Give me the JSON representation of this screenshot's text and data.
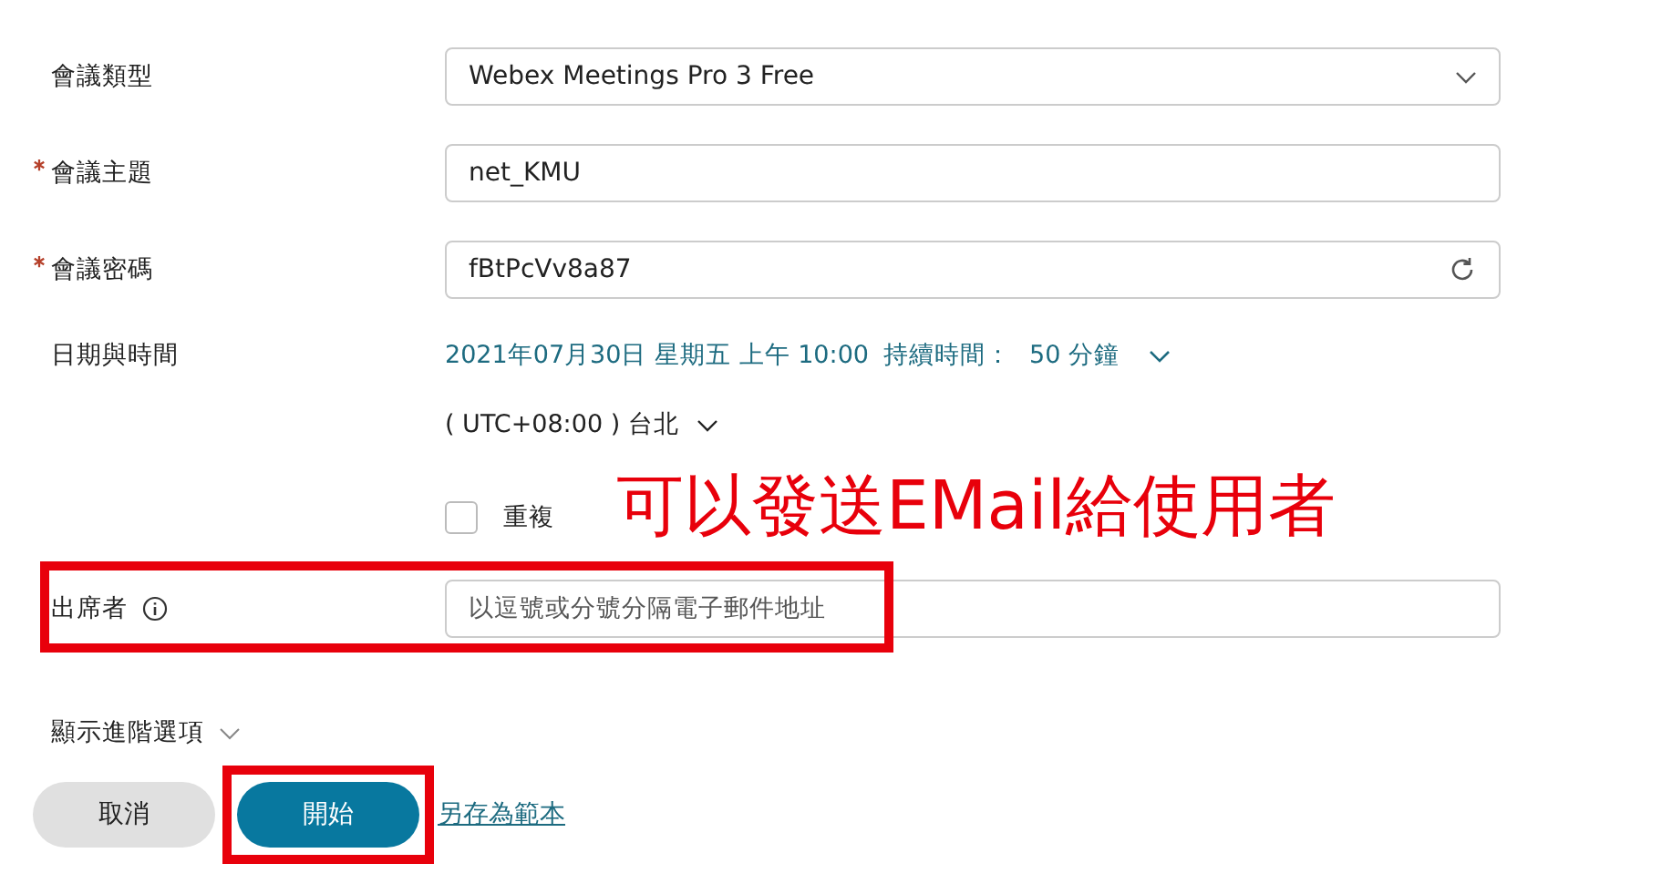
{
  "fields": [
    {
      "kind": "select",
      "label": "會議類型",
      "required": false,
      "value": "Webex Meetings Pro 3 Free"
    },
    {
      "kind": "text",
      "label": "會議主題",
      "required": true,
      "value": "net_KMU"
    },
    {
      "kind": "password",
      "label": "會議密碼",
      "required": true,
      "value": "fBtPcVv8a87"
    }
  ],
  "schedule": {
    "label": "日期與時間",
    "datetime": "2021年07月30日 星期五 上午 10:00",
    "duration_label": "持續時間：",
    "duration": "50 分鐘",
    "timezone": "( UTC+08:00 ) 台北"
  },
  "recurrence": {
    "label": "重複",
    "checked": false
  },
  "attendees": {
    "label": "出席者",
    "placeholder": "以逗號或分號分隔電子郵件地址",
    "highlighted": true
  },
  "advanced": {
    "label": "顯示進階選項",
    "expanded": false
  },
  "buttons": [
    {
      "kind": "secondary",
      "label": "取消",
      "highlighted": false
    },
    {
      "kind": "primary",
      "label": "開始",
      "highlighted": true
    },
    {
      "kind": "link",
      "label": "另存為範本",
      "highlighted": false
    }
  ],
  "annotation": "可以發送EMail給使用者"
}
